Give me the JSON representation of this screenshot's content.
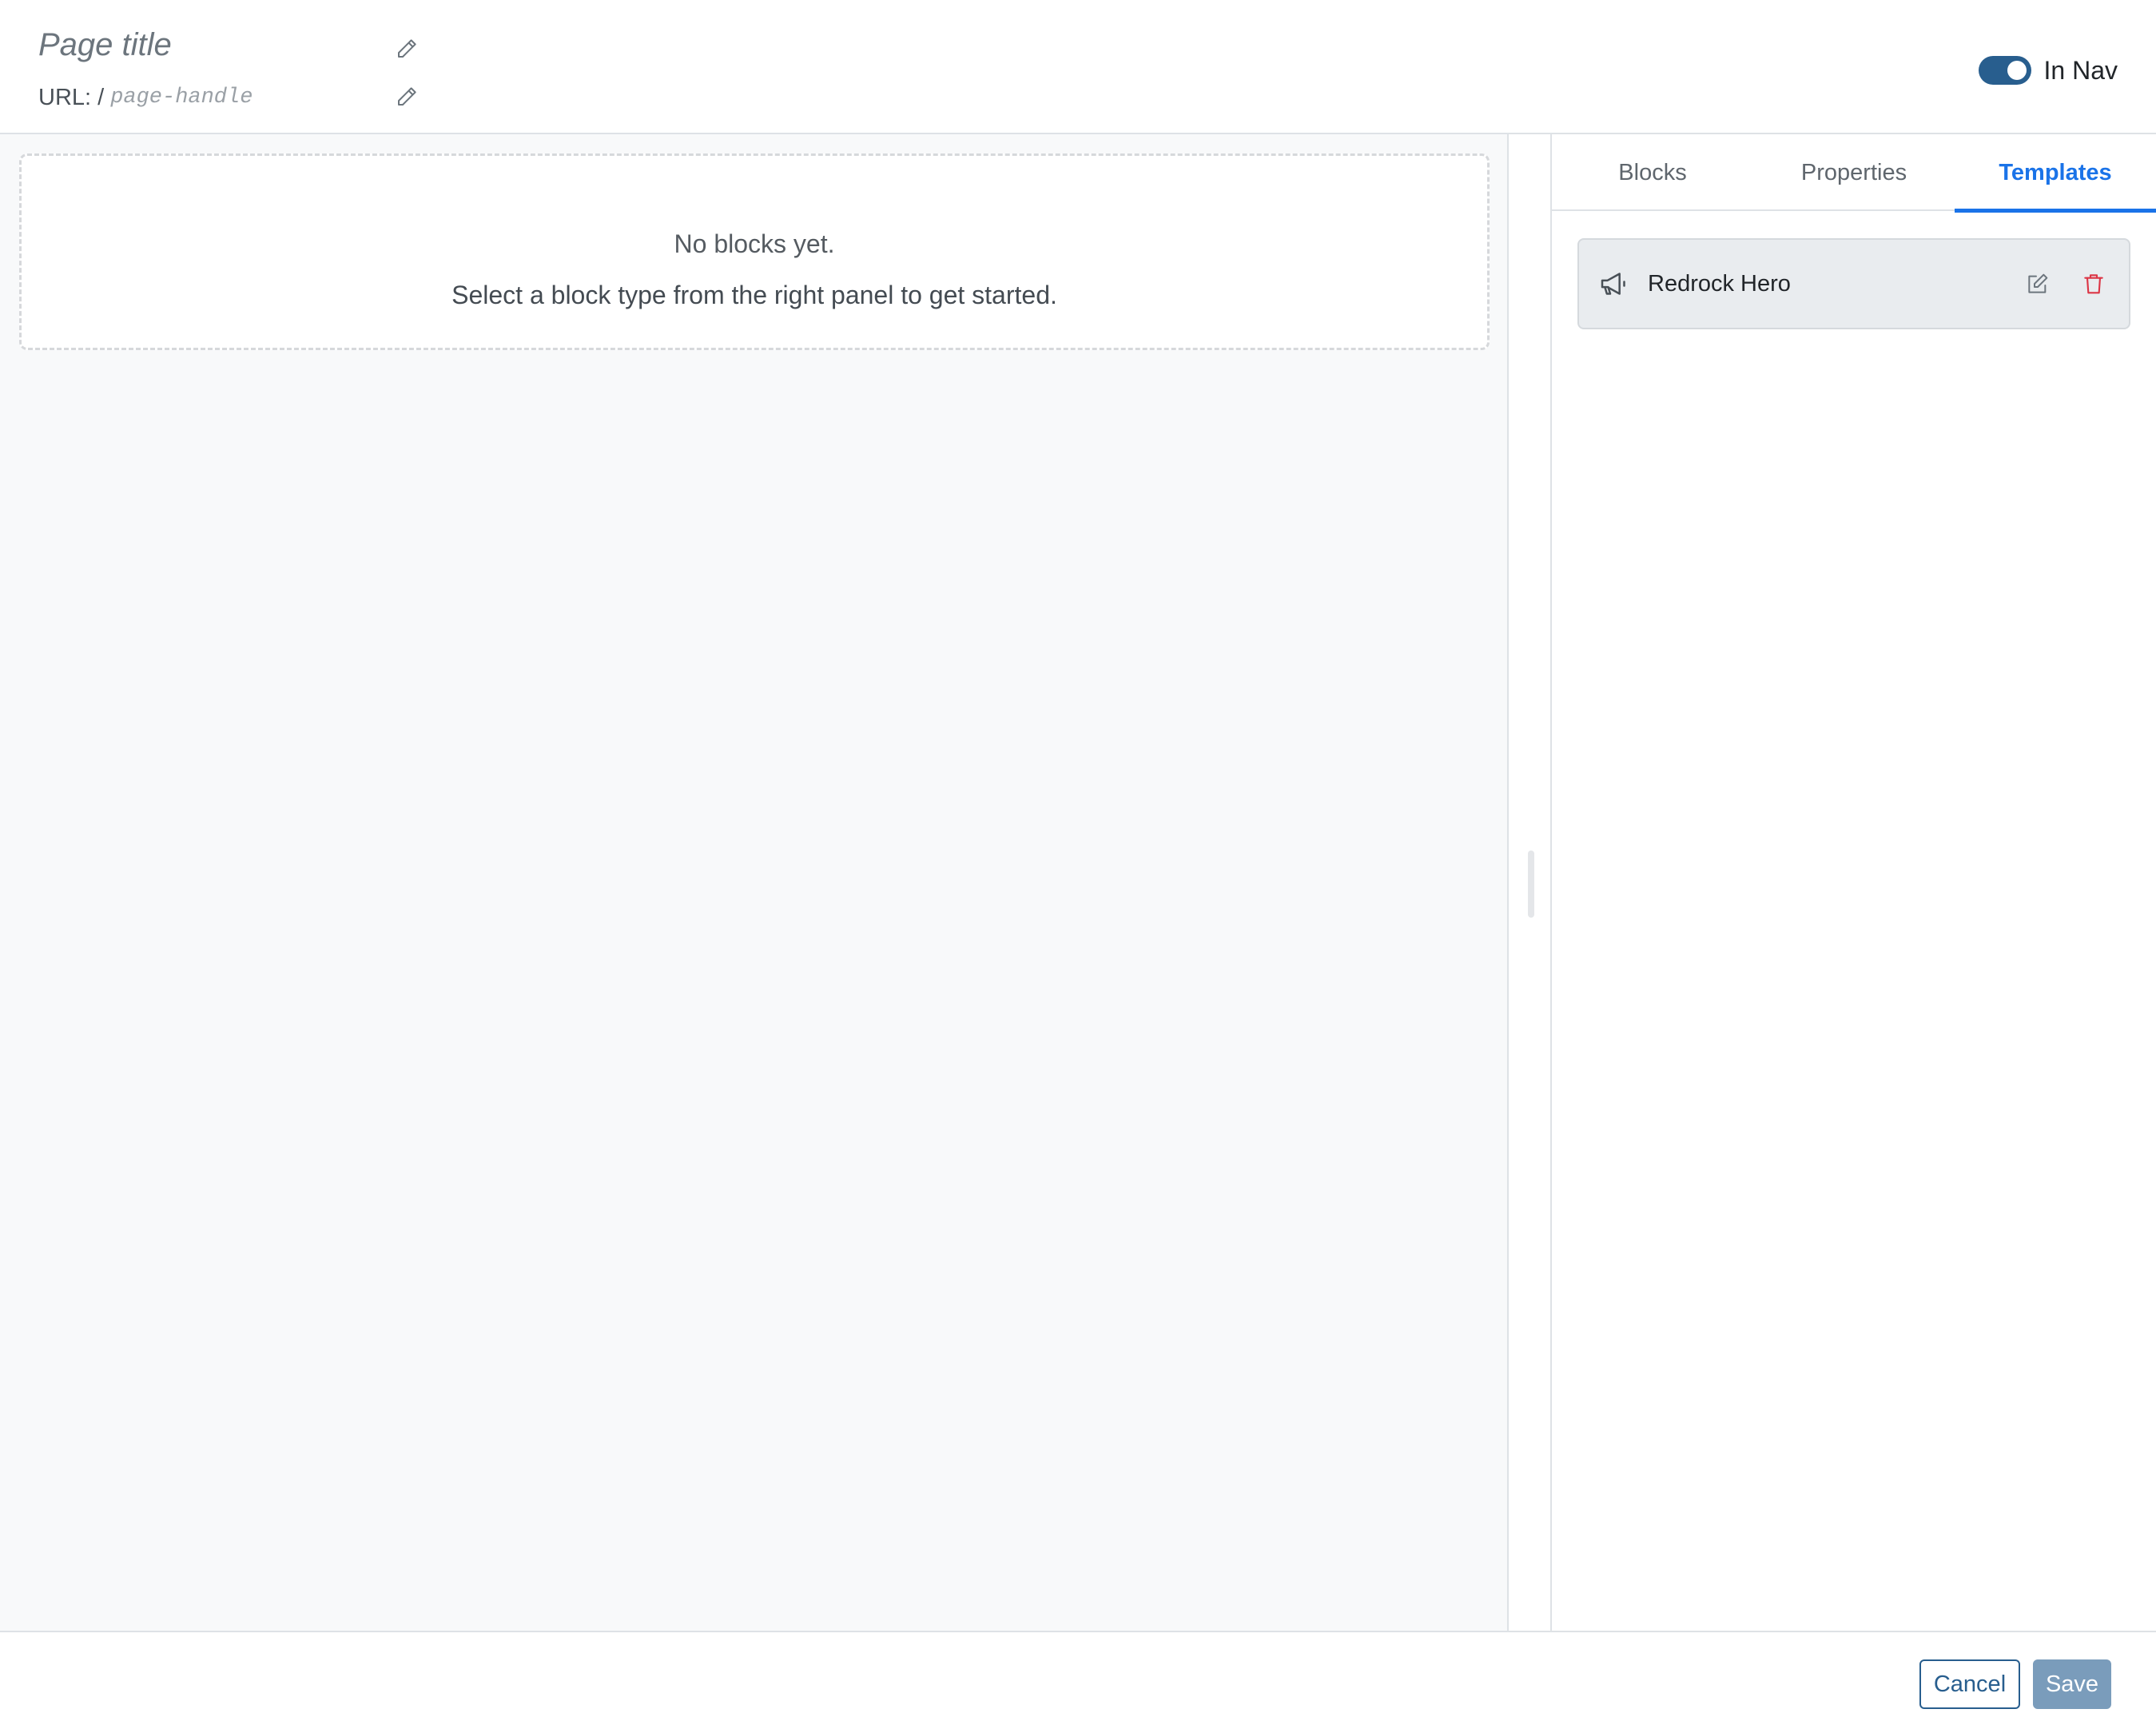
{
  "header": {
    "title_placeholder": "Page title",
    "url_prefix": "URL: /",
    "url_handle_placeholder": "page-handle",
    "in_nav_label": "In Nav",
    "in_nav_enabled": true
  },
  "canvas": {
    "empty_title": "No blocks yet.",
    "empty_hint": "Select a block type from the right panel to get started."
  },
  "side_panel": {
    "tabs": [
      {
        "label": "Blocks",
        "active": false
      },
      {
        "label": "Properties",
        "active": false
      },
      {
        "label": "Templates",
        "active": true
      }
    ],
    "templates": [
      {
        "name": "Redrock Hero",
        "icon": "megaphone-icon"
      }
    ]
  },
  "footer": {
    "cancel_label": "Cancel",
    "save_label": "Save"
  },
  "colors": {
    "accent": "#1a73e8",
    "primary": "#285e8e",
    "save_disabled": "#7a9cbb",
    "danger": "#dc3545"
  }
}
